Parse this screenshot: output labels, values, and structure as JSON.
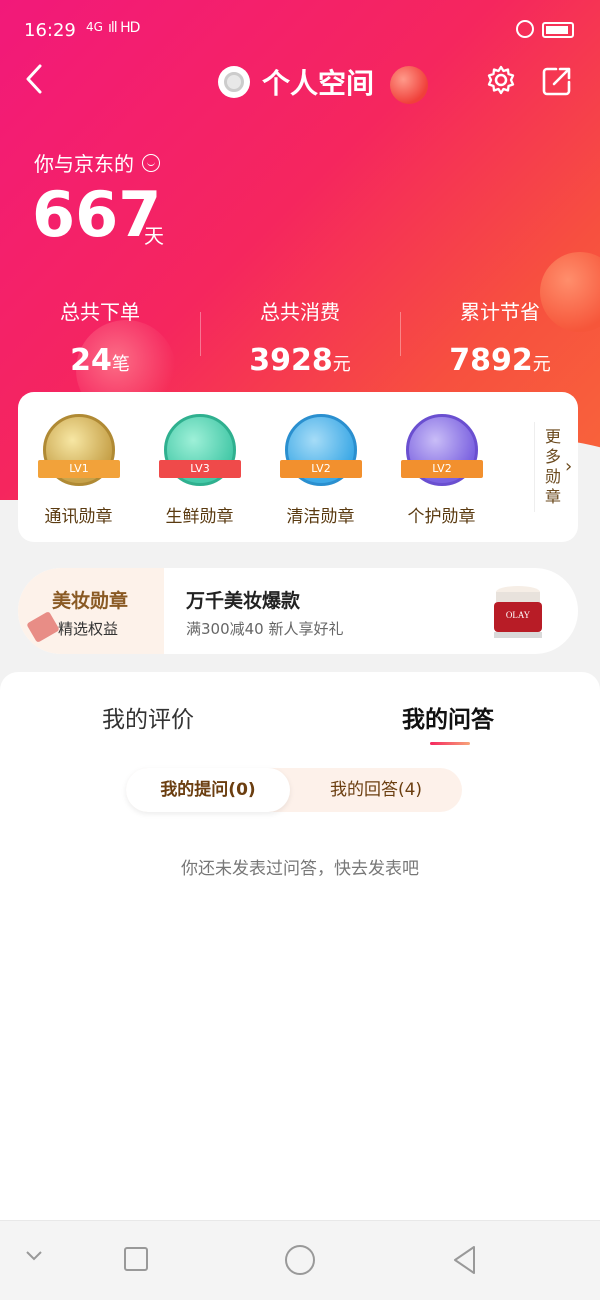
{
  "status_bar": {
    "time": "16:29",
    "network": "4G",
    "signal": "ıll HD",
    "lock_icon": "lock-circle-icon",
    "battery_icon": "battery-icon"
  },
  "nav": {
    "back_icon": "chevron-left-icon",
    "title": "个人空间",
    "settings_icon": "gear-icon",
    "share_icon": "share-square-icon"
  },
  "profile": {
    "days_label": "你与京东的",
    "days_value": "667",
    "days_unit": "天"
  },
  "stats": [
    {
      "label": "总共下单",
      "value": "24",
      "unit": "笔"
    },
    {
      "label": "总共消费",
      "value": "3928",
      "unit": "元"
    },
    {
      "label": "累计节省",
      "value": "7892",
      "unit": "元"
    }
  ],
  "badges": {
    "items": [
      {
        "name": "通讯勋章",
        "level": "LV1",
        "color": "#c7a24a"
      },
      {
        "name": "生鲜勋章",
        "level": "LV3",
        "color": "#46c9a8"
      },
      {
        "name": "清洁勋章",
        "level": "LV2",
        "color": "#3da9e6"
      },
      {
        "name": "个护勋章",
        "level": "LV2",
        "color": "#7b62e0"
      }
    ],
    "more_label": "更多勋章",
    "more_icon": "chevron-right-icon"
  },
  "promo": {
    "title": "美妆勋章",
    "subtitle": "精选权益",
    "headline": "万千美妆爆款",
    "description": "满300减40  新人享好礼",
    "product_brand": "OLAY"
  },
  "tabs": {
    "reviews": "我的评价",
    "qa": "我的问答",
    "active": "我的问答"
  },
  "segments": {
    "questions": "我的提问(0)",
    "answers": "我的回答(4)",
    "active": "我的提问(0)"
  },
  "empty_message": "你还未发表过问答，快去发表吧",
  "colors": {
    "hero_start": "#f2197a",
    "hero_end": "#f8663a",
    "accent_brown": "#8a5a24"
  }
}
